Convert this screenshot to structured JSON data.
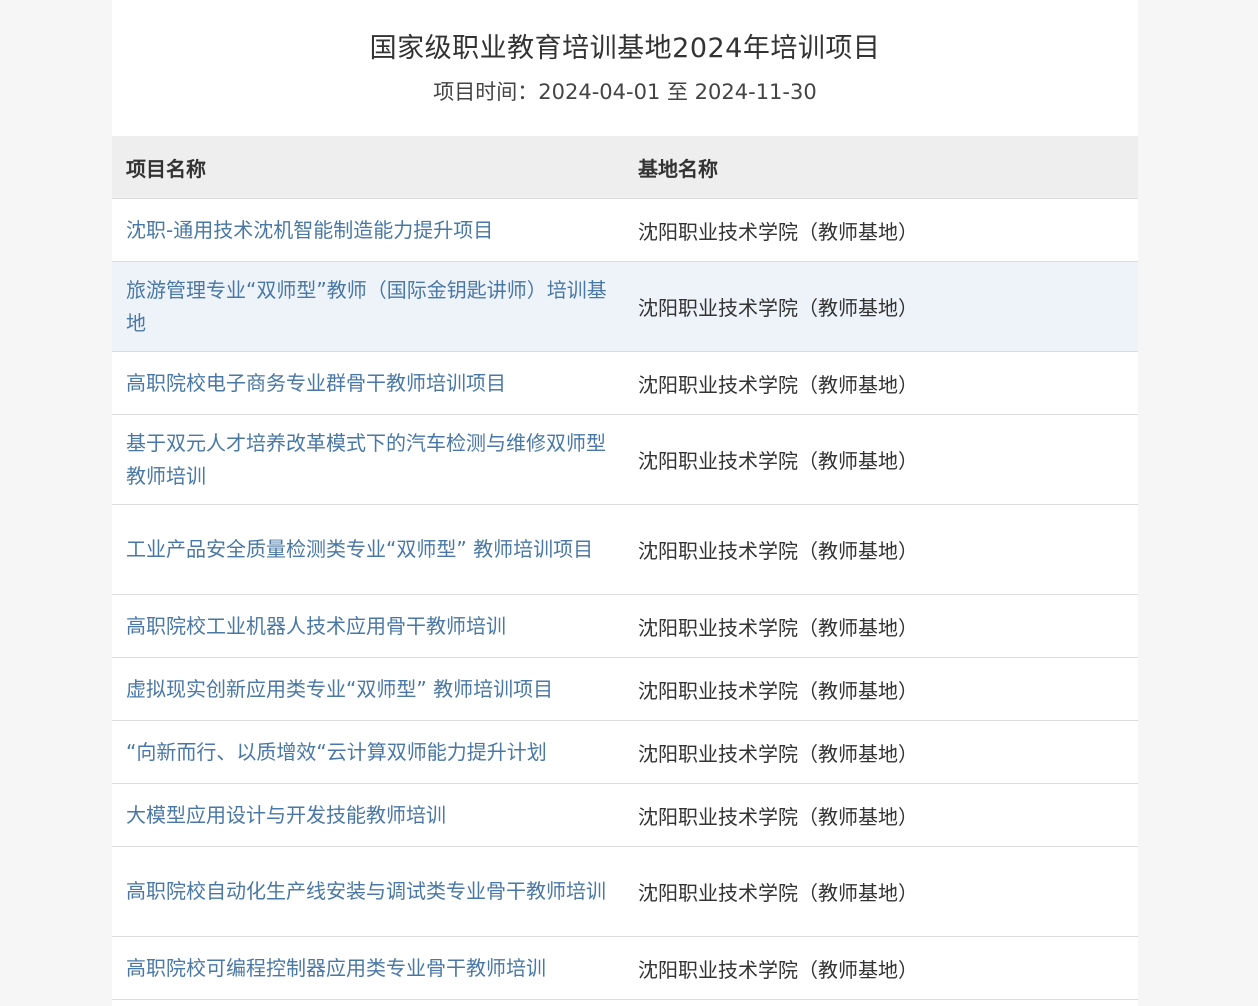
{
  "page": {
    "title": "国家级职业教育培训基地2024年培训项目",
    "subtitle": "项目时间：2024-04-01 至 2024-11-30"
  },
  "table": {
    "headers": [
      "项目名称",
      "基地名称"
    ],
    "rows": [
      {
        "project": "沈职-通用技术沈机智能制造能力提升项目",
        "base": "沈阳职业技术学院（教师基地）"
      },
      {
        "project": "旅游管理专业“双师型”教师（国际金钥匙讲师）培训基地",
        "base": "沈阳职业技术学院（教师基地）"
      },
      {
        "project": "高职院校电子商务专业群骨干教师培训项目",
        "base": "沈阳职业技术学院（教师基地）"
      },
      {
        "project": "基于双元人才培养改革模式下的汽车检测与维修双师型教师培训",
        "base": "沈阳职业技术学院（教师基地）"
      },
      {
        "project": "工业产品安全质量检测类专业“双师型” 教师培训项目",
        "base": "沈阳职业技术学院（教师基地）"
      },
      {
        "project": "高职院校工业机器人技术应用骨干教师培训",
        "base": "沈阳职业技术学院（教师基地）"
      },
      {
        "project": "虚拟现实创新应用类专业“双师型” 教师培训项目",
        "base": "沈阳职业技术学院（教师基地）"
      },
      {
        "project": "“向新而行、以质增效“云计算双师能力提升计划",
        "base": "沈阳职业技术学院（教师基地）"
      },
      {
        "project": "大模型应用设计与开发技能教师培训",
        "base": "沈阳职业技术学院（教师基地）"
      },
      {
        "project": "高职院校自动化生产线安装与调试类专业骨干教师培训",
        "base": "沈阳职业技术学院（教师基地）"
      },
      {
        "project": "高职院校可编程控制器应用类专业骨干教师培训",
        "base": "沈阳职业技术学院（教师基地）"
      }
    ]
  },
  "colors": {
    "link": "#4a78a6",
    "header_bg": "#eeeeee",
    "highlight_row_bg": "#eef3fa",
    "text": "#333333"
  }
}
